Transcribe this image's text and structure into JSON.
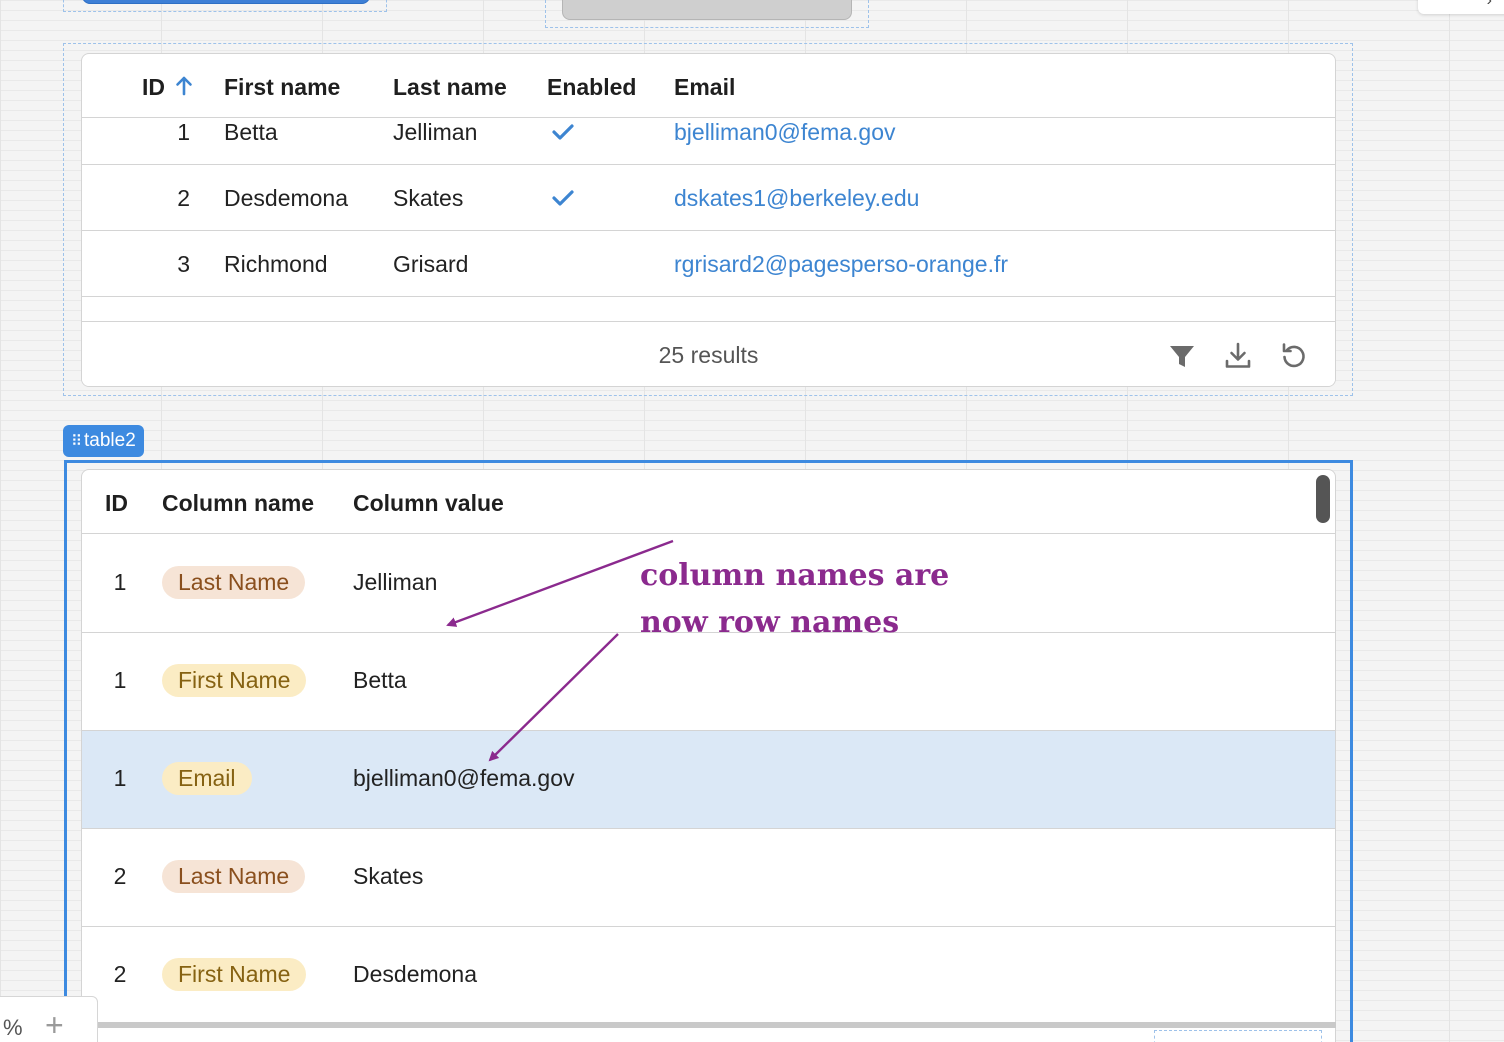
{
  "table1": {
    "columns": {
      "id": "ID",
      "first_name": "First name",
      "last_name": "Last name",
      "enabled": "Enabled",
      "email": "Email"
    },
    "sort": {
      "column": "ID",
      "direction": "ascending"
    },
    "rows": [
      {
        "id": "1",
        "first_name": "Betta",
        "last_name": "Jelliman",
        "enabled": true,
        "email": "bjelliman0@fema.gov"
      },
      {
        "id": "2",
        "first_name": "Desdemona",
        "last_name": "Skates",
        "enabled": true,
        "email": "dskates1@berkeley.edu"
      },
      {
        "id": "3",
        "first_name": "Richmond",
        "last_name": "Grisard",
        "enabled": false,
        "email": "rgrisard2@pagesperso-orange.fr"
      }
    ],
    "footer": {
      "results_text": "25 results",
      "icons": [
        "filter-icon",
        "download-icon",
        "reset-icon"
      ]
    }
  },
  "table2": {
    "component_label": "table2",
    "columns": {
      "id": "ID",
      "column_name": "Column name",
      "column_value": "Column value"
    },
    "rows": [
      {
        "id": "1",
        "column_name": "Last Name",
        "column_value": "Jelliman",
        "pill_color": "#f6e4d6"
      },
      {
        "id": "1",
        "column_name": "First Name",
        "column_value": "Betta",
        "pill_color": "#fbecc4"
      },
      {
        "id": "1",
        "column_name": "Email",
        "column_value": "bjelliman0@fema.gov",
        "pill_color": "#fbecc4",
        "selected": true
      },
      {
        "id": "2",
        "column_name": "Last Name",
        "column_value": "Skates",
        "pill_color": "#f6e4d6"
      },
      {
        "id": "2",
        "column_name": "First Name",
        "column_value": "Desdemona",
        "pill_color": "#fbecc4"
      }
    ]
  },
  "annotation": {
    "line1": "column names are",
    "line2": "now row names",
    "color": "#8b2a8e"
  },
  "zoom_control": {
    "percent_symbol": "%",
    "add_symbol": "+"
  },
  "colors": {
    "accent": "#3d8ae0",
    "link": "#3d85d1",
    "selected_row": "#dbe8f6"
  }
}
